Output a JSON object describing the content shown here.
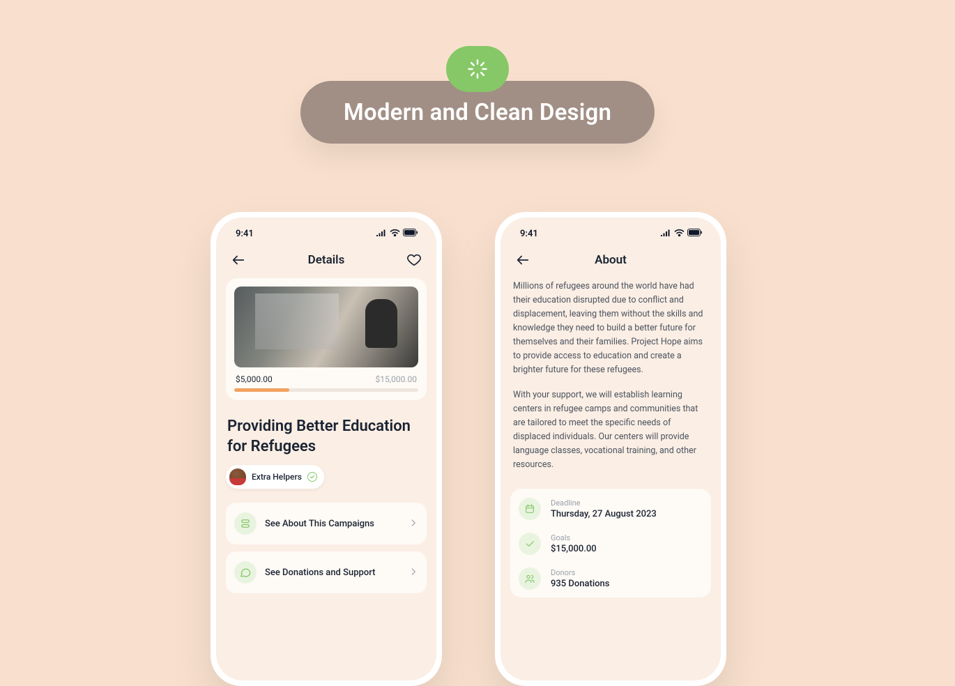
{
  "banner": {
    "title": "Modern and Clean Design"
  },
  "status": {
    "time": "9:41"
  },
  "details": {
    "nav_title": "Details",
    "raised": "$5,000.00",
    "goal": "$15,000.00",
    "campaign_title": "Providing Better Education for Refugees",
    "org_name": "Extra Helpers",
    "links": {
      "about": "See About This Campaigns",
      "donations": "See Donations and Support"
    }
  },
  "about": {
    "nav_title": "About",
    "para1": "Millions of refugees around the world have had their education disrupted due to conflict and displacement, leaving them without the skills and knowledge they need to build a better future for themselves and their families. Project Hope aims to provide access to education and create a brighter future for these refugees.",
    "para2": "With your support, we will establish learning centers in refugee camps and communities that are tailored to meet the specific needs of displaced individuals. Our centers will provide language classes, vocational training, and other resources.",
    "deadline_label": "Deadline",
    "deadline_value": "Thursday, 27 August 2023",
    "goals_label": "Goals",
    "goals_value": "$15,000.00",
    "donors_label": "Donors",
    "donors_value": "935 Donations"
  }
}
